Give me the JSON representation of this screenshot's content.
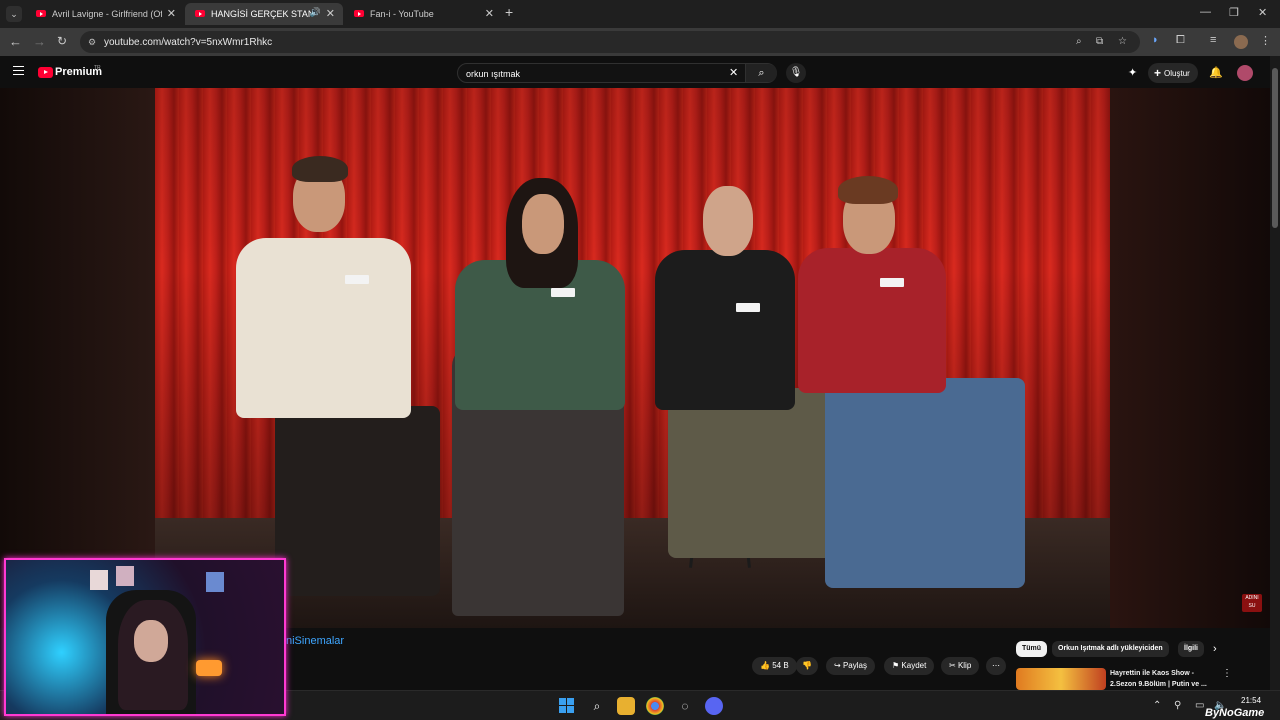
{
  "browser": {
    "tabs": [
      {
        "title": "Avril Lavigne - Girlfriend (Official",
        "active": false
      },
      {
        "title": "HANGİSİ GERÇEK STAND-UP",
        "active": true
      },
      {
        "title": "Fan-i - YouTube",
        "active": false
      }
    ],
    "new_tab": "+",
    "url": "youtube.com/watch?v=5nxWmr1Rhkc"
  },
  "youtube": {
    "logo_text": "Premium",
    "logo_region": "TR",
    "search_value": "orkun ışıtmak",
    "create_label": "Oluştur",
    "channel_name": "niSinemalar",
    "actions": {
      "like_count": "54 B",
      "share": "Paylaş",
      "save": "Kaydet",
      "clip": "Klip",
      "more": "⋯"
    },
    "chips": [
      "Tümü",
      "Orkun Işıtmak adlı yükleyiciden",
      "İlgili"
    ],
    "recommended": {
      "title": "Hayrettin ile Kaos Show - 2.Sezon 9.Bölüm | Putin ve ..."
    },
    "watermark": "ADINI SU"
  },
  "taskbar": {
    "time": "21:54",
    "date": "",
    "overlay_brand": "ByNoGame"
  },
  "colors": {
    "youtube_red": "#ff0033",
    "link_blue": "#3ea6ff",
    "webcam_border": "#ff3ad2"
  }
}
